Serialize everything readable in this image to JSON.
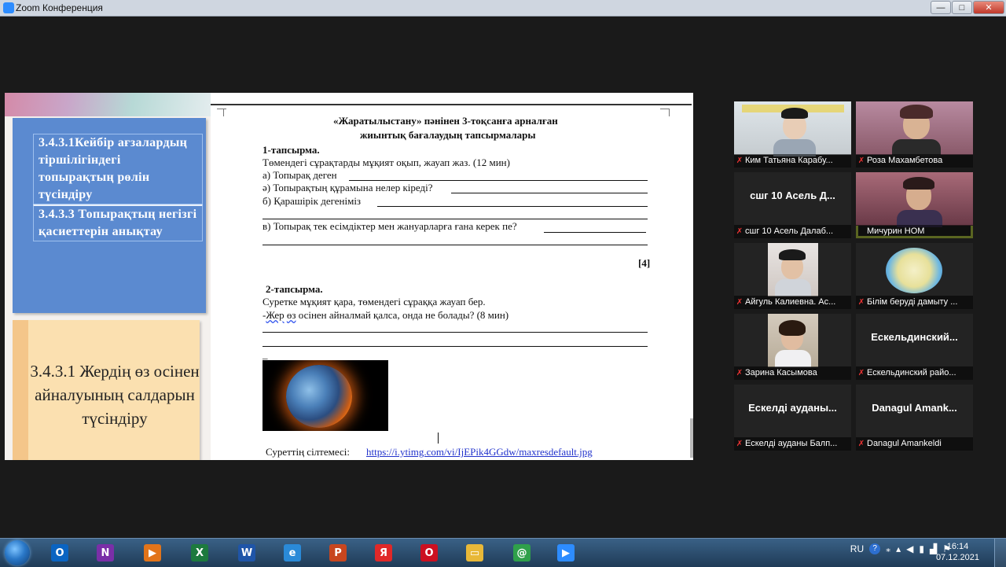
{
  "window": {
    "title": "Zoom Конференция",
    "btn_min": "—",
    "btn_max": "□",
    "btn_close": "✕"
  },
  "slide": {
    "objective1": "3.4.3.1Кейбір ағзалардың тіршілігіндегі топырақтың рөлін түсіндіру",
    "objective2": "3.4.3.3 Топырақтың негізгі қасиеттерін анықтау",
    "objective3": "3.4.3.1 Жердің өз осінен айналуының салдарын түсіндіру"
  },
  "doc": {
    "title1": "«Жаратылыстану» пәнінен 3-тоқсанға арналған",
    "title2": "жиынтық бағалаудың  тапсырмалары",
    "task1_head": "1-тапсырма.",
    "task1_instr": "Төмендегі сұрақтарды мұқият оқып,  жауап жаз.      (12 мин)",
    "q_a": "а) Топырақ деген",
    "q_ae": "ә) Топырақтың құрамына нелер кіреді?",
    "q_b": "б) Қарашірік   дегеніміз",
    "q_v": "в) Топырақ тек есімдіктер мен жануарларға ғана керек пе?",
    "score": "[4]",
    "task2_head": "2-тапсырма.",
    "task2_instr": "Суретке мұқият қара, төмендегі сұраққа жауап бер.",
    "task2_q_prefix": "-",
    "task2_q_w1": "Жер",
    "task2_q_w2": "өз",
    "task2_q_rest": " осінен  айналмай қалса, онда не болады?      (8 мин)",
    "dash": "_",
    "ref_label": "Суреттің сілтемесі:",
    "ref_url": "https://i.ytimg.com/vi/IjEPik4GGdw/maxresdefault.jpg"
  },
  "participants": [
    {
      "name": "Ким Татьяна Карабу...",
      "type": "video"
    },
    {
      "name": "Роза Махамбетова",
      "type": "video"
    },
    {
      "name": "сшг 10 Асель Далаб...",
      "type": "text",
      "center": "сшг 10 Асель Д..."
    },
    {
      "name": "Мичурин НОМ",
      "type": "video",
      "active": true
    },
    {
      "name": "Айгуль Калиевна. Ас...",
      "type": "video"
    },
    {
      "name": "Білім беруді дамыту ...",
      "type": "logo"
    },
    {
      "name": "Зарина Касымова",
      "type": "video"
    },
    {
      "name": "Ескельдинский райо...",
      "type": "text",
      "center": "Ескельдинский..."
    },
    {
      "name": "Ескелді ауданы Балп...",
      "type": "text",
      "center": "Ескелді ауданы..."
    },
    {
      "name": "Danagul Amankeldi",
      "type": "text",
      "center": "Danagul  Amank..."
    }
  ],
  "taskbar": {
    "apps": [
      {
        "icon": "outlook-icon",
        "glyph": "O",
        "color": "#0a64c2"
      },
      {
        "icon": "onenote-icon",
        "glyph": "N",
        "color": "#7a2fa8"
      },
      {
        "icon": "media-player-icon",
        "glyph": "▶",
        "color": "#e2741a"
      },
      {
        "icon": "excel-icon",
        "glyph": "X",
        "color": "#1d7a3e"
      },
      {
        "icon": "word-icon",
        "glyph": "W",
        "color": "#1f55a8"
      },
      {
        "icon": "ie-icon",
        "glyph": "e",
        "color": "#2a8ad8"
      },
      {
        "icon": "powerpoint-icon",
        "glyph": "P",
        "color": "#c8461f"
      },
      {
        "icon": "yandex-icon",
        "glyph": "Я",
        "color": "#e02828"
      },
      {
        "icon": "opera-icon",
        "glyph": "O",
        "color": "#cc1020"
      },
      {
        "icon": "folder-icon",
        "glyph": "▭",
        "color": "#e8b838"
      },
      {
        "icon": "mail-agent-icon",
        "glyph": "@",
        "color": "#2fa04a"
      },
      {
        "icon": "zoom-icon",
        "glyph": "▶",
        "color": "#2d8cff"
      }
    ],
    "lang": "RU",
    "time": "16:14",
    "date": "07.12.2021"
  }
}
